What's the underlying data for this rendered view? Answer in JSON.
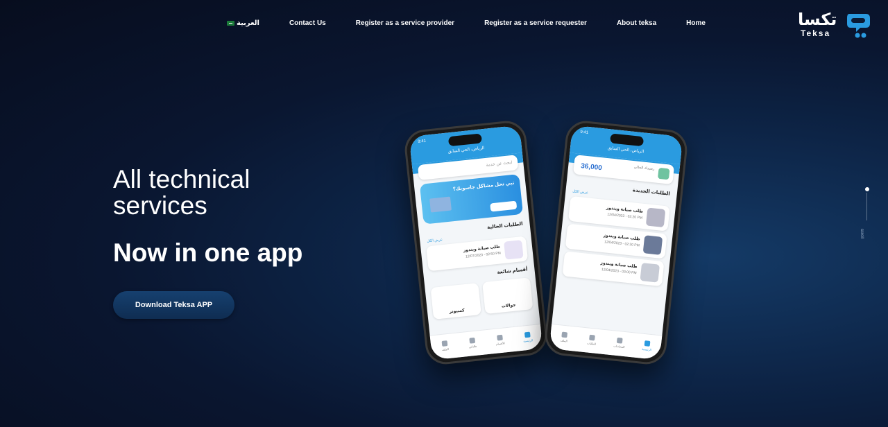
{
  "nav": {
    "home": "Home",
    "about": "About teksa",
    "register_requester": "Register as a service requester",
    "register_provider": "Register as a service provider",
    "contact": "Contact Us",
    "language": "العربية"
  },
  "logo": {
    "arabic": "تكسا",
    "english": "Teksa"
  },
  "hero": {
    "line1": "All technical",
    "line2": "services",
    "subtitle": "Now in one app",
    "download_label": "Download Teksa APP"
  },
  "scroll_indicator": {
    "label": "scroll"
  },
  "phone1": {
    "time": "9:41",
    "location": "الرياض، الحي السابق",
    "search_placeholder": "ابحث عن خدمة",
    "banner_title": "تبي تحل مشاكل جاسوبك؟",
    "section_requests": "الطلبات الحالية",
    "see_all": "عرض الكل",
    "request_title": "طلب صيانة ويندوز",
    "request_meta": "12/07/2023 - 02:50 PM",
    "section_categories": "أقسام شائعة",
    "tile_mobile": "جوالات",
    "tile_computer": "كمبيوتر",
    "tabs": [
      "الرئيسية",
      "الأقسام",
      "طلباتي",
      "الملف"
    ]
  },
  "phone2": {
    "time": "9:41",
    "location": "الرياض، الحي السابق",
    "balance_label": "رصيدك الحالي",
    "balance_amount": "36,000",
    "section_new": "الطلبات الجديدة",
    "see_all": "عرض الكل",
    "requests": [
      {
        "title": "طلب صيانة ويندوز",
        "meta": "12/04/2023 - 02:20 PM"
      },
      {
        "title": "طلب صيانة ويندوز",
        "meta": "12/04/2023 - 02:20 PM"
      },
      {
        "title": "طلب صيانة ويندوز",
        "meta": "12/04/2023 - 03:00 PM"
      }
    ],
    "tabs": [
      "الرئيسية",
      "المحادثات",
      "الطلبات",
      "الملف"
    ]
  }
}
